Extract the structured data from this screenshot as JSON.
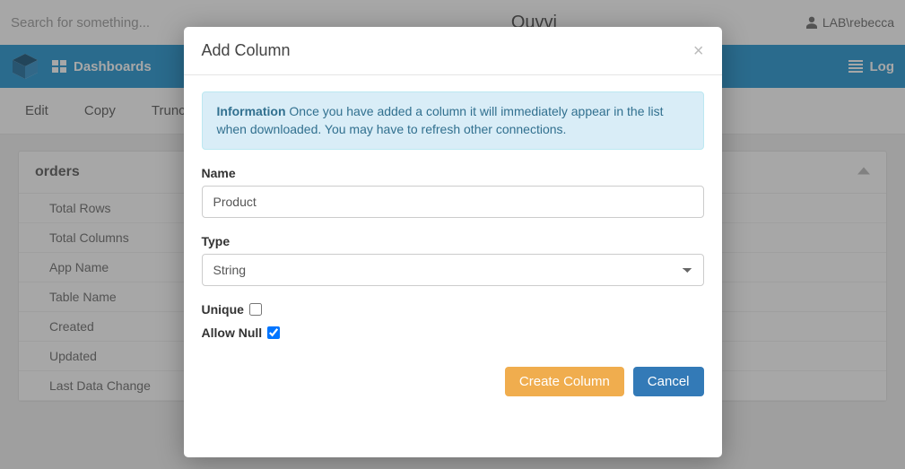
{
  "topbar": {
    "search_placeholder": "Search for something...",
    "brand": "Ouvvi",
    "user": "LAB\\rebecca"
  },
  "nav": {
    "dashboards": "Dashboards",
    "log": "Log"
  },
  "toolbar": {
    "edit": "Edit",
    "copy": "Copy",
    "truncate": "Truncate"
  },
  "panel": {
    "title": "orders",
    "stats": [
      "Total Rows",
      "Total Columns",
      "App Name",
      "Table Name",
      "Created",
      "Updated",
      "Last Data Change"
    ]
  },
  "modal": {
    "title": "Add Column",
    "info_label": "Information",
    "info_text": " Once you have added a column it will immediately appear in the list when downloaded. You may have to refresh other connections.",
    "name_label": "Name",
    "name_value": "Product",
    "type_label": "Type",
    "type_value": "String",
    "unique_label": "Unique",
    "unique_checked": false,
    "allow_null_label": "Allow Null",
    "allow_null_checked": true,
    "create_btn": "Create Column",
    "cancel_btn": "Cancel"
  }
}
